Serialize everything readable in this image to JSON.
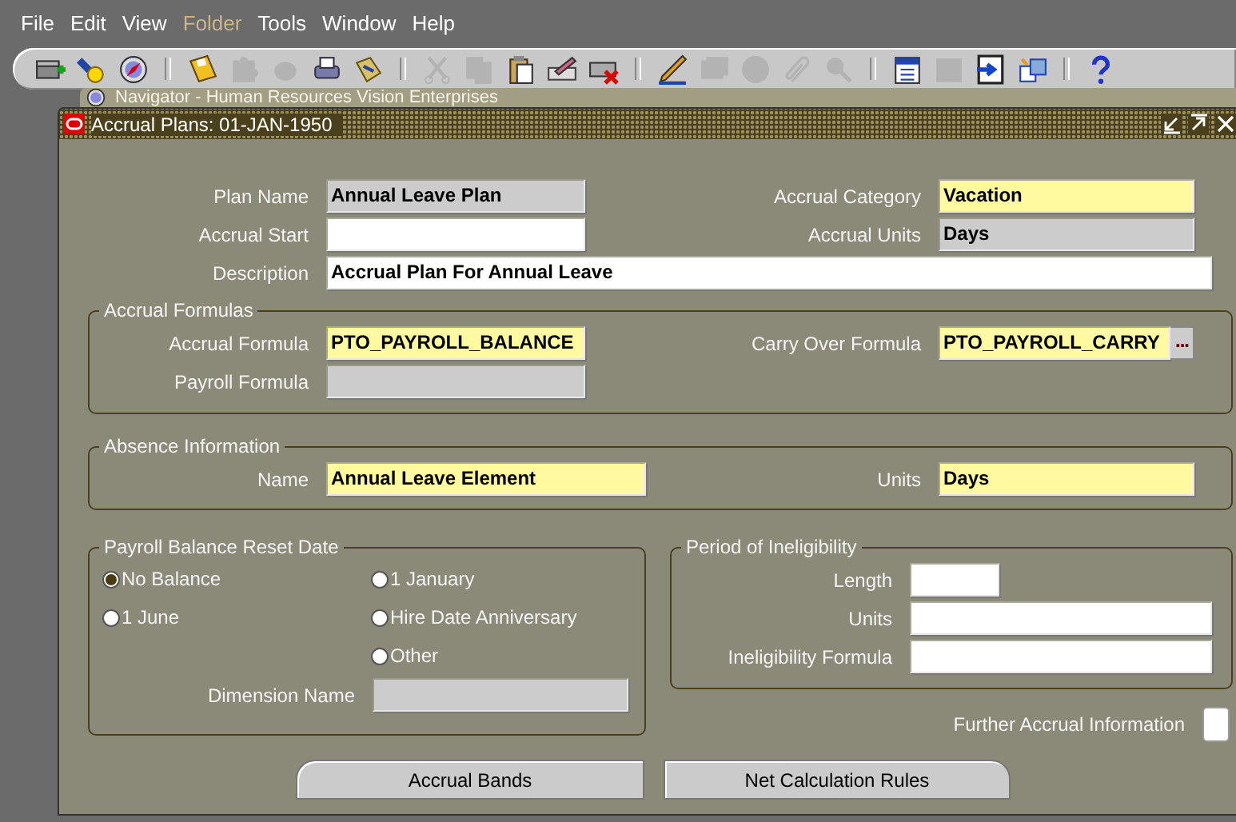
{
  "menu_bar": [
    {
      "label": "File",
      "disabled": false
    },
    {
      "label": "Edit",
      "disabled": false
    },
    {
      "label": "View",
      "disabled": false
    },
    {
      "label": "Folder",
      "disabled": true
    },
    {
      "label": "Tools",
      "disabled": false
    },
    {
      "label": "Window",
      "disabled": false
    },
    {
      "label": "Help",
      "disabled": false
    }
  ],
  "toolbar": [
    [
      {
        "kind": "new",
        "disabled": false
      },
      {
        "kind": "find",
        "disabled": false
      },
      {
        "kind": "navigator",
        "disabled": false
      }
    ],
    [
      {
        "kind": "save",
        "disabled": false
      },
      {
        "kind": "next-step",
        "disabled": true
      },
      {
        "kind": "switch",
        "disabled": true
      },
      {
        "kind": "print",
        "disabled": false
      },
      {
        "kind": "close-form",
        "disabled": false
      }
    ],
    [
      {
        "kind": "cut",
        "disabled": true
      },
      {
        "kind": "copy",
        "disabled": true
      },
      {
        "kind": "paste",
        "disabled": false
      },
      {
        "kind": "clear",
        "disabled": false
      },
      {
        "kind": "delete",
        "disabled": false
      }
    ],
    [
      {
        "kind": "edit",
        "disabled": false
      },
      {
        "kind": "zoom",
        "disabled": true
      },
      {
        "kind": "globe",
        "disabled": true
      },
      {
        "kind": "attach",
        "disabled": true
      },
      {
        "kind": "folder-tools",
        "disabled": true
      }
    ],
    [
      {
        "kind": "calendar",
        "disabled": false
      },
      {
        "kind": "table",
        "disabled": true
      },
      {
        "kind": "export",
        "disabled": false
      },
      {
        "kind": "windows",
        "disabled": false
      }
    ],
    [
      {
        "kind": "help",
        "disabled": false
      }
    ]
  ],
  "background_window": {
    "title": "Navigator - Human Resources Vision Enterprises"
  },
  "window": {
    "title": "Accrual Plans: 01-JAN-1950"
  },
  "header_rows": [
    [
      {
        "label": "Plan Name",
        "value": "Annual Leave Plan",
        "required": false,
        "read_only": true
      },
      {
        "label": "Accrual Category",
        "value": "Vacation",
        "required": true,
        "read_only": false
      }
    ],
    [
      {
        "label": "Accrual Start",
        "required": false,
        "read_only": false
      },
      {
        "label": "Accrual Units",
        "value": "Days",
        "required": false,
        "read_only": true
      }
    ],
    [
      {
        "label": "Description",
        "value": "Accrual Plan For Annual Leave",
        "required": false,
        "read_only": false
      }
    ]
  ],
  "accrual_formulas": {
    "title": "Accrual Formulas",
    "rows": [
      [
        {
          "label": "Accrual Formula",
          "value": "PTO_PAYROLL_BALANCE",
          "required": true,
          "read_only": false
        },
        {
          "label": "Carry Over Formula",
          "value": "PTO_PAYROLL_CARRY",
          "required": true,
          "read_only": false,
          "button": "..."
        }
      ],
      [
        {
          "label": "Payroll Formula",
          "required": false,
          "read_only": true
        }
      ]
    ]
  },
  "absence_information": {
    "title": "Absence Information",
    "rows": [
      [
        {
          "label": "Name",
          "value": "Annual Leave Element",
          "required": true,
          "read_only": false
        },
        {
          "label": "Units",
          "value": "Days",
          "required": true,
          "read_only": false
        }
      ]
    ]
  },
  "payroll_balance_reset_date": {
    "title": "Payroll Balance Reset Date",
    "options": [
      {
        "label": "No Balance",
        "selected": true
      },
      {
        "label": "1 January",
        "selected": false
      },
      {
        "label": "1 June",
        "selected": false
      },
      {
        "label": "Hire Date Anniversary",
        "selected": false
      },
      {
        "label": "Other",
        "selected": false
      }
    ],
    "dimension_name": {
      "label": "Dimension Name",
      "required": false,
      "read_only": true
    }
  },
  "period_of_ineligibility": {
    "title": "Period of Ineligibility",
    "fields": [
      {
        "label": "Length",
        "required": false,
        "read_only": false,
        "kind": "number"
      },
      {
        "label": "Units",
        "required": false,
        "read_only": false,
        "kind": "text"
      },
      {
        "label": "Ineligibility Formula",
        "required": false,
        "read_only": false,
        "kind": "text"
      }
    ]
  },
  "further_accrual_information": {
    "label": "Further Accrual Information",
    "checked": false
  },
  "buttons": [
    {
      "label": "Accrual Bands"
    },
    {
      "label": "Net Calculation Rules"
    }
  ]
}
